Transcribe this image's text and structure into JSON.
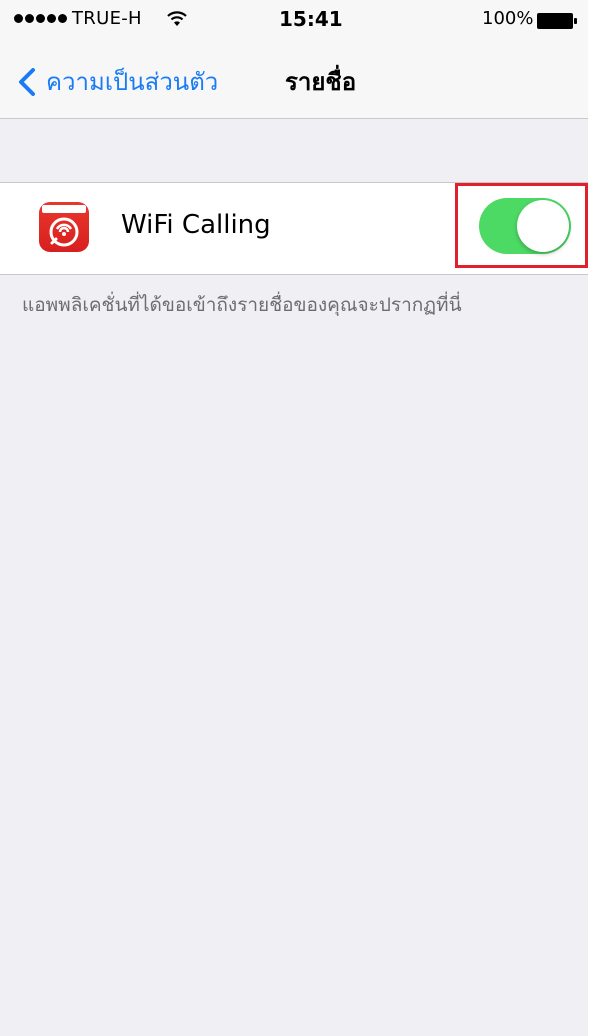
{
  "status_bar": {
    "carrier": "TRUE-H",
    "time": "15:41",
    "battery_percent": "100%",
    "signal_strength": 5,
    "battery_level": 1.0
  },
  "nav": {
    "back_label": "ความเป็นส่วนตัว",
    "title": "รายชื่อ",
    "accent_color": "#1a7cf5"
  },
  "list": {
    "items": [
      {
        "label": "WiFi Calling",
        "toggle_on": true,
        "icon": "wifi-calling-app-icon"
      }
    ]
  },
  "footer": {
    "note": "แอพพลิเคชั่นที่ได้ขอเข้าถึงรายชื่อของคุณจะปรากฏที่นี่"
  },
  "colors": {
    "toggle_on": "#4cd964",
    "highlight": "#e0212d",
    "app_icon": "#e8372c"
  }
}
